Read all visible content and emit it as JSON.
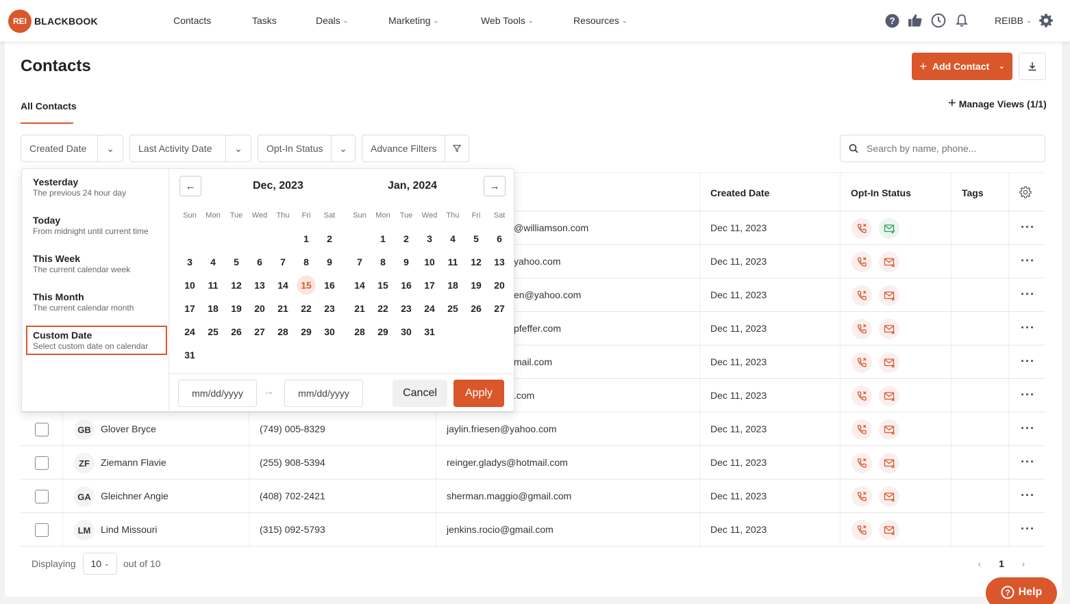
{
  "nav": {
    "logo_badge": "REI",
    "logo_text": "BLACKBOOK",
    "items": [
      {
        "label": "Contacts",
        "caret": false
      },
      {
        "label": "Tasks",
        "caret": false
      },
      {
        "label": "Deals",
        "caret": true
      },
      {
        "label": "Marketing",
        "caret": true
      },
      {
        "label": "Web Tools",
        "caret": true
      },
      {
        "label": "Resources",
        "caret": true
      }
    ],
    "icons": [
      "help-icon",
      "thumbs-up-icon",
      "clock-icon",
      "bell-icon"
    ],
    "user": "REIBB"
  },
  "page": {
    "title": "Contacts",
    "add_contact": "Add Contact",
    "tab_all": "All Contacts",
    "manage_views": "Manage Views (1/1)"
  },
  "filters": {
    "created_date": "Created Date",
    "last_activity": "Last Activity Date",
    "opt_in": "Opt-In Status",
    "advance": "Advance Filters",
    "search_placeholder": "Search by name, phone..."
  },
  "table": {
    "headers": {
      "created_date": "Created Date",
      "opt_in": "Opt-In Status",
      "tags": "Tags"
    },
    "rows": [
      {
        "initials": "",
        "name": "",
        "phone": "",
        "email": "@williamson.com",
        "created": "Dec 11, 2023",
        "email_ok": true
      },
      {
        "initials": "",
        "name": "",
        "phone": "",
        "email": "yahoo.com",
        "created": "Dec 11, 2023",
        "email_ok": false
      },
      {
        "initials": "",
        "name": "",
        "phone": "",
        "email": "en@yahoo.com",
        "created": "Dec 11, 2023",
        "email_ok": false
      },
      {
        "initials": "",
        "name": "",
        "phone": "",
        "email": "pfeffer.com",
        "created": "Dec 11, 2023",
        "email_ok": false
      },
      {
        "initials": "",
        "name": "",
        "phone": "",
        "email": "mail.com",
        "created": "Dec 11, 2023",
        "email_ok": false
      },
      {
        "initials": "",
        "name": "",
        "phone": "",
        "email": ".com",
        "created": "Dec 11, 2023",
        "email_ok": false
      },
      {
        "initials": "GB",
        "name": "Glover Bryce",
        "phone": "(749) 005-8329",
        "email": "jaylin.friesen@yahoo.com",
        "created": "Dec 11, 2023",
        "email_ok": false
      },
      {
        "initials": "ZF",
        "name": "Ziemann Flavie",
        "phone": "(255) 908-5394",
        "email": "reinger.gladys@hotmail.com",
        "created": "Dec 11, 2023",
        "email_ok": false
      },
      {
        "initials": "GA",
        "name": "Gleichner Angie",
        "phone": "(408) 702-2421",
        "email": "sherman.maggio@gmail.com",
        "created": "Dec 11, 2023",
        "email_ok": false
      },
      {
        "initials": "LM",
        "name": "Lind Missouri",
        "phone": "(315) 092-5793",
        "email": "jenkins.rocio@gmail.com",
        "created": "Dec 11, 2023",
        "email_ok": false
      }
    ]
  },
  "footer": {
    "displaying": "Displaying",
    "per_page": "10",
    "out_of": "out of 10",
    "page": "1"
  },
  "date_picker": {
    "presets": [
      {
        "title": "Yesterday",
        "sub": "The previous 24 hour day",
        "selected": false
      },
      {
        "title": "Today",
        "sub": "From midnight until current time",
        "selected": false
      },
      {
        "title": "This Week",
        "sub": "The current calendar week",
        "selected": false
      },
      {
        "title": "This Month",
        "sub": "The current calendar month",
        "selected": false
      },
      {
        "title": "Custom Date",
        "sub": "Select custom date on calendar",
        "selected": true
      }
    ],
    "weekdays": [
      "Sun",
      "Mon",
      "Tue",
      "Wed",
      "Thu",
      "Fri",
      "Sat"
    ],
    "months": [
      {
        "title": "Dec, 2023",
        "first_weekday": 5,
        "days": 31,
        "today": 15
      },
      {
        "title": "Jan, 2024",
        "first_weekday": 1,
        "days": 31,
        "today": null
      }
    ],
    "start_placeholder": "mm/dd/yyyy",
    "end_placeholder": "mm/dd/yyyy",
    "cancel": "Cancel",
    "apply": "Apply"
  },
  "help_button": "Help",
  "colors": {
    "accent": "#d9572b",
    "success": "#2e9e5b"
  }
}
